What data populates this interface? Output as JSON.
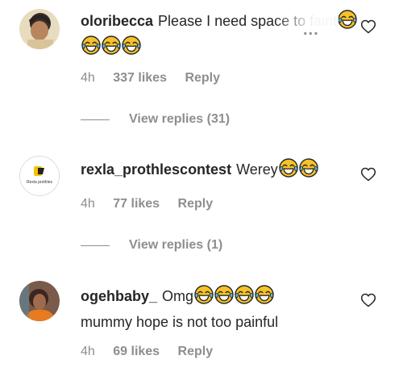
{
  "comments": [
    {
      "username": "oloribecca",
      "text": "Please I need space to faint",
      "emoji": [
        "laugh-cry-emoji",
        "laugh-cry-emoji",
        "laugh-cry-emoji",
        "laugh-cry-emoji"
      ],
      "time": "4h",
      "likes": "337 likes",
      "reply_label": "Reply",
      "view_replies": "View replies (31)",
      "more_label": "..."
    },
    {
      "username": "rexla_prothlescontest",
      "avatar_text": "Rexla prothles",
      "text": "Werey",
      "emoji": [
        "laugh-cry-emoji",
        "laugh-cry-emoji"
      ],
      "time": "4h",
      "likes": "77 likes",
      "reply_label": "Reply",
      "view_replies": "View replies (1)"
    },
    {
      "username": "ogehbaby_",
      "text": "Omg",
      "text_line2": "mummy hope is not too painful",
      "emoji": [
        "laugh-cry-emoji",
        "laugh-cry-emoji",
        "laugh-cry-emoji",
        "laugh-cry-emoji"
      ],
      "time": "4h",
      "likes": "69 likes",
      "reply_label": "Reply"
    }
  ],
  "colors": {
    "text": "#262626",
    "secondary": "#8e8e8e",
    "emoji_face": "#f6c229"
  }
}
